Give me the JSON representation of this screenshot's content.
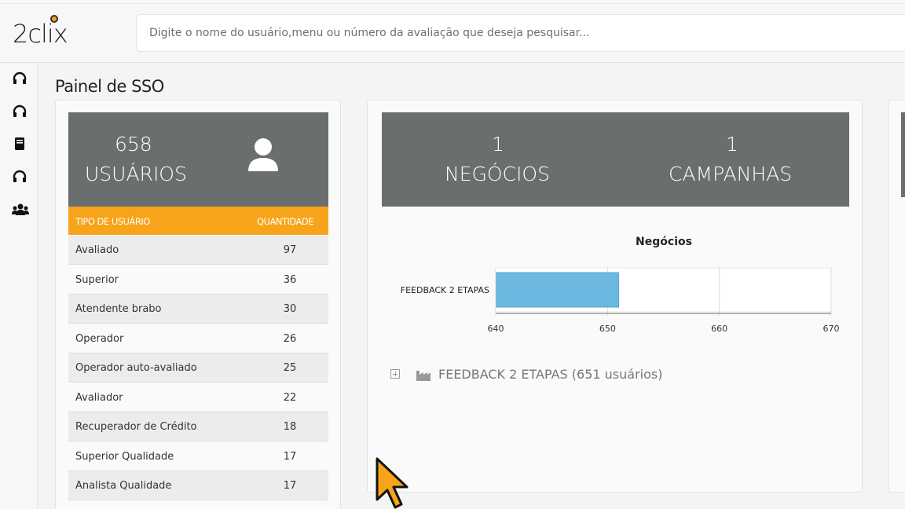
{
  "header": {
    "logo_text": "2clix",
    "search_placeholder": "Digite o nome do usuário,menu ou número da avaliação que deseja pesquisar..."
  },
  "sidebar": {
    "icons": [
      "headset-icon",
      "headset-icon",
      "book-icon",
      "headset-icon",
      "users-icon"
    ]
  },
  "page": {
    "title": "Painel de SSO"
  },
  "users_card": {
    "count": "658",
    "label": "USUÁRIOS",
    "icon": "user-icon",
    "table": {
      "headers": [
        "TIPO DE USUÁRIO",
        "QUANTIDADE"
      ],
      "rows": [
        {
          "type": "Avaliado",
          "qty": "97"
        },
        {
          "type": "Superior",
          "qty": "36"
        },
        {
          "type": "Atendente brabo",
          "qty": "30"
        },
        {
          "type": "Operador",
          "qty": "26"
        },
        {
          "type": "Operador auto-avaliado",
          "qty": "25"
        },
        {
          "type": "Avaliador",
          "qty": "22"
        },
        {
          "type": "Recuperador de Crédito",
          "qty": "18"
        },
        {
          "type": "Superior Qualidade",
          "qty": "17"
        },
        {
          "type": "Analista Qualidade",
          "qty": "17"
        }
      ]
    }
  },
  "business_card": {
    "negocios_count": "1",
    "negocios_label": "NEGÓCIOS",
    "campanhas_count": "1",
    "campanhas_label": "CAMPANHAS",
    "tree_item": "FEEDBACK 2 ETAPAS (651 usuários)"
  },
  "colors": {
    "accent_orange": "#f7a41a",
    "stat_gray": "#6a6e6e",
    "bar_blue": "#6bb9e0"
  },
  "chart_data": {
    "type": "bar",
    "orientation": "horizontal",
    "title": "Negócios",
    "categories": [
      "FEEDBACK 2 ETAPAS"
    ],
    "values": [
      651
    ],
    "xlim": [
      640,
      670
    ],
    "xticks": [
      "640",
      "650",
      "660",
      "670"
    ],
    "grid": true
  }
}
